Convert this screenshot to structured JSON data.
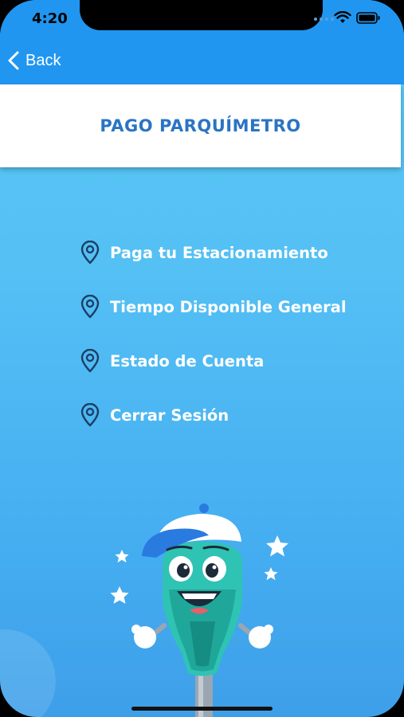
{
  "status_bar": {
    "time": "4:20",
    "icons": [
      "cellular-dots-icon",
      "wifi-icon",
      "battery-icon"
    ]
  },
  "nav": {
    "back_label": "Back",
    "back_icon": "chevron-left-icon"
  },
  "header": {
    "title": "PAGO PARQUÍMETRO"
  },
  "menu": {
    "items": [
      {
        "label": "Paga tu Estacionamiento",
        "icon": "location-pin-icon"
      },
      {
        "label": "Tiempo Disponible General",
        "icon": "location-pin-icon"
      },
      {
        "label": "Estado de Cuenta",
        "icon": "location-pin-icon"
      },
      {
        "label": "Cerrar Sesión",
        "icon": "location-pin-icon"
      }
    ]
  },
  "colors": {
    "nav_blue": "#2196f0",
    "title_blue": "#2a74c4",
    "background_top": "#5cc9f7",
    "background_bottom": "#3e9fe9",
    "mascot_teal": "#2fc3b4",
    "cap_blue": "#2a7be0"
  }
}
